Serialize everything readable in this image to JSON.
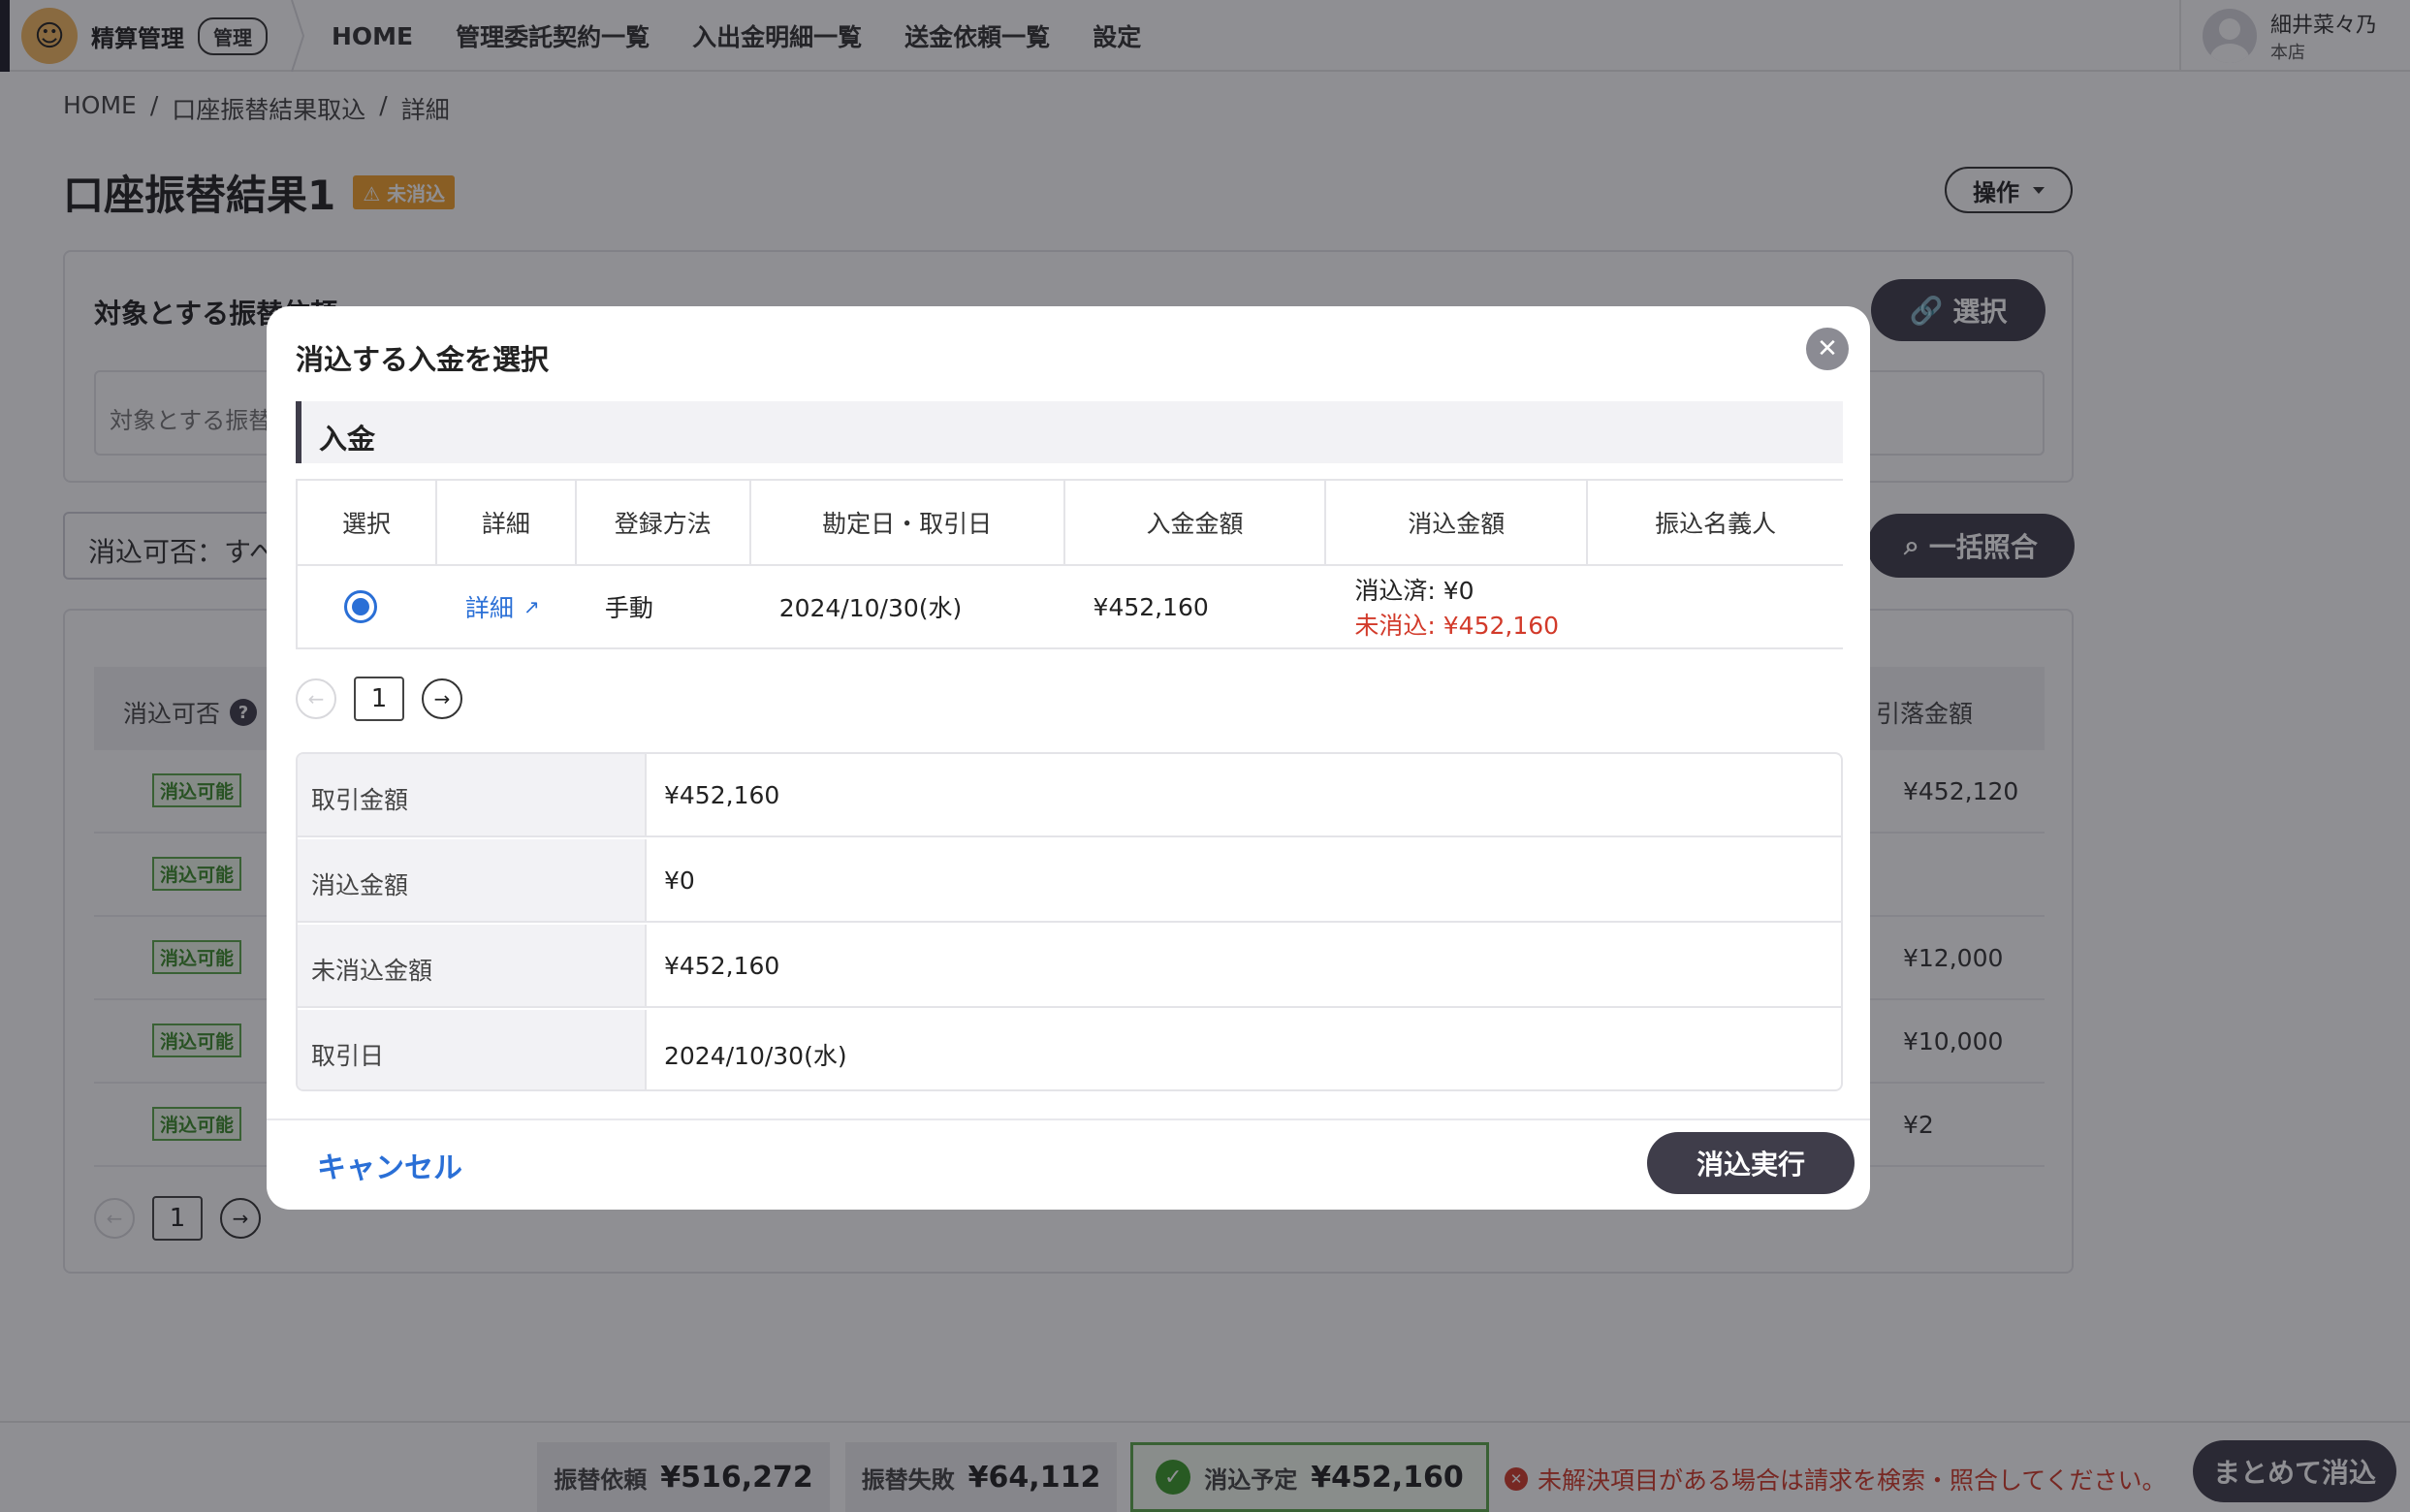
{
  "header": {
    "brand_name": "精算管理",
    "brand_badge": "管理",
    "nav": [
      "HOME",
      "管理委託契約一覧",
      "入出金明細一覧",
      "送金依頼一覧",
      "設定"
    ],
    "user_name": "細井菜々乃",
    "user_branch": "本店"
  },
  "breadcrumb": [
    "HOME",
    "/",
    "口座振替結果取込",
    "/",
    "詳細"
  ],
  "page": {
    "title": "口座振替結果1",
    "status_badge": "未消込",
    "ops_label": "操作"
  },
  "target": {
    "title": "対象とする振替依頼",
    "placeholder": "対象とする振替依頼",
    "select_label": "選択"
  },
  "filter": {
    "label": "消込可否：すべて",
    "bulk_label": "一括照合"
  },
  "background_table": {
    "col_first": "消込可否",
    "col_last": "引落金額",
    "rows": [
      {
        "status": "消込可能",
        "amount": "¥452,120"
      },
      {
        "status": "消込可能",
        "amount": ""
      },
      {
        "status": "消込可能",
        "amount": "¥12,000"
      },
      {
        "status": "消込可能",
        "amount": "¥10,000"
      },
      {
        "status": "消込可能",
        "amount": "¥2"
      }
    ],
    "page": "1"
  },
  "modal": {
    "title": "消込する入金を選択",
    "section": "入金",
    "columns": [
      "選択",
      "詳細",
      "登録方法",
      "勘定日・取引日",
      "入金金額",
      "消込金額",
      "振込名義人"
    ],
    "row": {
      "detail_link": "詳細",
      "method": "手動",
      "date": "2024/10/30(水)",
      "amount": "¥452,160",
      "cleared": "消込済: ¥0",
      "uncleared": "未消込: ¥452,160",
      "payer": ""
    },
    "page": "1",
    "details": [
      {
        "label": "取引金額",
        "value": "¥452,160"
      },
      {
        "label": "消込金額",
        "value": "¥0"
      },
      {
        "label": "未消込金額",
        "value": "¥452,160"
      },
      {
        "label": "取引日",
        "value": "2024/10/30(水)"
      }
    ],
    "cancel_label": "キャンセル",
    "exec_label": "消込実行"
  },
  "footer": {
    "request_label": "振替依頼",
    "request_amount": "¥516,272",
    "failed_label": "振替失敗",
    "failed_amount": "¥64,112",
    "planned_label": "消込予定",
    "planned_amount": "¥452,160",
    "error_message": "未解決項目がある場合は請求を検索・照合してください。",
    "bulk_clear_label": "まとめて消込"
  },
  "colors": {
    "primary_dark": "#3f3d4a",
    "link_blue": "#2a6fd6",
    "error_red": "#d23a2a",
    "success_green": "#3a9a2a",
    "warning_orange": "#f4a22b"
  }
}
